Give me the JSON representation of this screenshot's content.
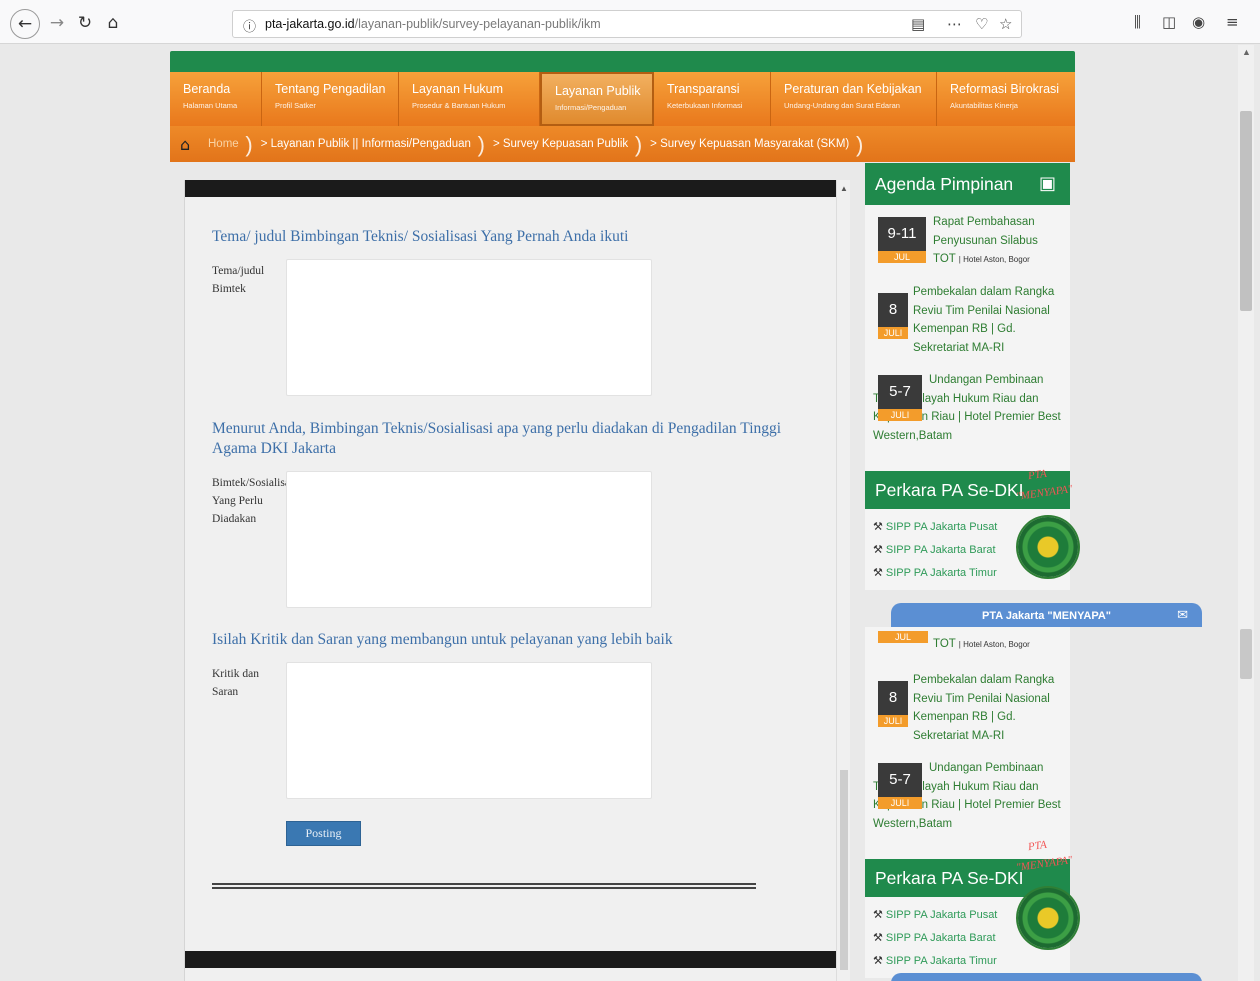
{
  "browser": {
    "url_domain": "pta-jakarta.go.id",
    "url_path": "/layanan-publik/survey-pelayanan-publik/ikm",
    "icons": [
      "back-arrow-icon",
      "forward-arrow-icon",
      "reload-icon",
      "home-icon",
      "info-icon",
      "reader-icon",
      "more-icon",
      "pocket-icon",
      "star-icon",
      "library-icon",
      "sidebar-icon",
      "account-icon",
      "menu-icon"
    ]
  },
  "menu": [
    {
      "title": "Beranda",
      "sub": "Halaman Utama"
    },
    {
      "title": "Tentang Pengadilan",
      "sub": "Profil Satker"
    },
    {
      "title": "Layanan Hukum",
      "sub": "Prosedur & Bantuan Hukum"
    },
    {
      "title": "Layanan Publik",
      "sub": "Informasi/Pengaduan",
      "active": true
    },
    {
      "title": "Transparansi",
      "sub": "Keterbukaan Informasi"
    },
    {
      "title": "Peraturan dan Kebijakan",
      "sub": "Undang-Undang dan Surat Edaran"
    },
    {
      "title": "Reformasi Birokrasi",
      "sub": "Akuntabilitas Kinerja"
    }
  ],
  "breadcrumb": [
    "Home",
    "> Layanan Publik || Informasi/Pengaduan",
    "> Survey Kepuasan Publik",
    "> Survey Kepuasan Masyarakat (SKM)"
  ],
  "form": {
    "q1": "Tema/ judul Bimbingan Teknis/ Sosialisasi Yang Pernah Anda ikuti",
    "q1_label": "Tema/judul Bimtek",
    "q2": "Menurut Anda, Bimbingan Teknis/Sosialisasi apa yang perlu diadakan di Pengadilan Tinggi Agama DKI Jakarta",
    "q2_label": "Bimtek/Sosialisasi Yang Perlu Diadakan",
    "q3": "Isilah Kritik dan Saran yang membangun untuk pelayanan yang lebih baik",
    "q3_label": "Kritik dan Saran",
    "submit": "Posting"
  },
  "sidebar": {
    "agenda_title": "Agenda Pimpinan",
    "agenda": [
      {
        "day": "9-11",
        "month": "JUL",
        "text": "Rapat Pembahasan Penyusunan Silabus TOT",
        "loc": "| Hotel Aston, Bogor"
      },
      {
        "day": "8",
        "month": "JULI",
        "text": "Pembekalan dalam Rangka Reviu Tim Penilai Nasional Kemenpan RB | Gd. Sekretariat MA-RI"
      },
      {
        "day": "5-7",
        "month": "JULI",
        "text": "Undangan Pembinaan Teknis Wilayah Hukum Riau dan Kepulauan Riau | Hotel Premier Best Western,Batam"
      }
    ],
    "agenda_repeat_first": {
      "month": "JUL",
      "text": "TOT",
      "loc": "| Hotel Aston, Bogor"
    },
    "perkara_title": "Perkara PA Se-DKI",
    "perkara_links": [
      "SIPP PA Jakarta Pusat",
      "SIPP PA Jakarta Barat",
      "SIPP PA Jakarta Timur"
    ],
    "logo_text_1": "PTA",
    "logo_text_2": "\"MENYAPA\""
  },
  "menyapa_bar": "PTA Jakarta \"MENYAPA\"",
  "colors": {
    "green": "#1f8a4c",
    "orange": "#ee8a28",
    "link_blue": "#3d6fa8",
    "button_blue": "#3a78b2"
  }
}
